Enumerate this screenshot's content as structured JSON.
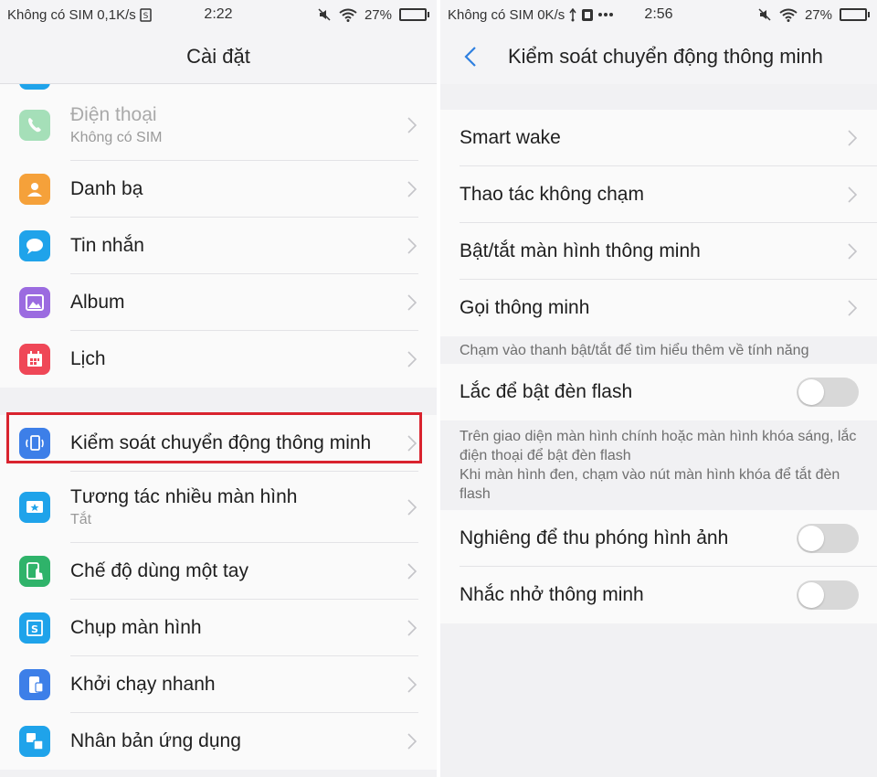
{
  "left": {
    "status": {
      "carrier": "Không có SIM",
      "speed": "0,1K/s",
      "time": "2:22",
      "battery": "27%",
      "battery_level": 0.27
    },
    "title": "Cài đặt",
    "group1": [
      {
        "label": "Điện thoại",
        "sub": "Không có SIM",
        "icon": "phone-icon",
        "color": "#3fbf6a"
      },
      {
        "label": "Danh bạ",
        "icon": "contacts-icon",
        "color": "#f5a13a"
      },
      {
        "label": "Tin nhắn",
        "icon": "message-icon",
        "color": "#1fa3ea"
      },
      {
        "label": "Album",
        "icon": "album-icon",
        "color": "#9b6be0"
      },
      {
        "label": "Lịch",
        "icon": "calendar-icon",
        "color": "#ef4757"
      }
    ],
    "group2": [
      {
        "label": "Kiểm soát chuyển động thông minh",
        "icon": "motion-control-icon",
        "color": "#3d7fe8"
      },
      {
        "label": "Tương tác nhiều màn hình",
        "sub": "Tắt",
        "icon": "multiscreen-icon",
        "color": "#1fa3ea"
      },
      {
        "label": "Chế độ dùng một tay",
        "icon": "one-hand-icon",
        "color": "#2fb36a"
      },
      {
        "label": "Chụp màn hình",
        "icon": "screenshot-icon",
        "color": "#1fa3ea"
      },
      {
        "label": "Khởi chạy nhanh",
        "icon": "quick-launch-icon",
        "color": "#3d7fe8"
      },
      {
        "label": "Nhân bản ứng dụng",
        "icon": "app-clone-icon",
        "color": "#1fa3ea"
      }
    ],
    "highlight_color": "#d9232e"
  },
  "right": {
    "status": {
      "carrier": "Không có SIM",
      "speed": "0K/s",
      "time": "2:56",
      "battery": "27%",
      "battery_level": 0.27
    },
    "title": "Kiểm soát chuyển động thông minh",
    "nav_items": [
      {
        "label": "Smart wake"
      },
      {
        "label": "Thao tác không chạm"
      },
      {
        "label": "Bật/tắt màn hình thông minh"
      },
      {
        "label": "Gọi thông minh"
      }
    ],
    "hint1": "Chạm vào thanh bật/tắt để tìm hiểu thêm về tính năng",
    "flash": {
      "label": "Lắc để bật đèn flash",
      "on": false
    },
    "hint2_line1": "Trên giao diện màn hình chính hoặc màn hình khóa sáng, lắc điện thoại để bật đèn flash",
    "hint2_line2": "Khi màn hình đen, chạm vào nút màn hình khóa để tắt đèn flash",
    "tilt": {
      "label": "Nghiêng để thu phóng hình ảnh",
      "on": false
    },
    "reminder": {
      "label": "Nhắc nhở thông minh",
      "on": false
    },
    "accent": "#2f80e0"
  }
}
